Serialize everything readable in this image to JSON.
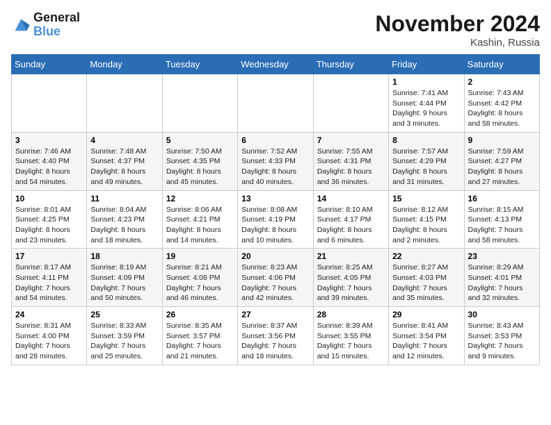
{
  "logo": {
    "line1": "General",
    "line2": "Blue"
  },
  "title": "November 2024",
  "location": "Kashin, Russia",
  "weekdays": [
    "Sunday",
    "Monday",
    "Tuesday",
    "Wednesday",
    "Thursday",
    "Friday",
    "Saturday"
  ],
  "weeks": [
    [
      {
        "day": "",
        "info": ""
      },
      {
        "day": "",
        "info": ""
      },
      {
        "day": "",
        "info": ""
      },
      {
        "day": "",
        "info": ""
      },
      {
        "day": "",
        "info": ""
      },
      {
        "day": "1",
        "info": "Sunrise: 7:41 AM\nSunset: 4:44 PM\nDaylight: 9 hours\nand 3 minutes."
      },
      {
        "day": "2",
        "info": "Sunrise: 7:43 AM\nSunset: 4:42 PM\nDaylight: 8 hours\nand 58 minutes."
      }
    ],
    [
      {
        "day": "3",
        "info": "Sunrise: 7:46 AM\nSunset: 4:40 PM\nDaylight: 8 hours\nand 54 minutes."
      },
      {
        "day": "4",
        "info": "Sunrise: 7:48 AM\nSunset: 4:37 PM\nDaylight: 8 hours\nand 49 minutes."
      },
      {
        "day": "5",
        "info": "Sunrise: 7:50 AM\nSunset: 4:35 PM\nDaylight: 8 hours\nand 45 minutes."
      },
      {
        "day": "6",
        "info": "Sunrise: 7:52 AM\nSunset: 4:33 PM\nDaylight: 8 hours\nand 40 minutes."
      },
      {
        "day": "7",
        "info": "Sunrise: 7:55 AM\nSunset: 4:31 PM\nDaylight: 8 hours\nand 36 minutes."
      },
      {
        "day": "8",
        "info": "Sunrise: 7:57 AM\nSunset: 4:29 PM\nDaylight: 8 hours\nand 31 minutes."
      },
      {
        "day": "9",
        "info": "Sunrise: 7:59 AM\nSunset: 4:27 PM\nDaylight: 8 hours\nand 27 minutes."
      }
    ],
    [
      {
        "day": "10",
        "info": "Sunrise: 8:01 AM\nSunset: 4:25 PM\nDaylight: 8 hours\nand 23 minutes."
      },
      {
        "day": "11",
        "info": "Sunrise: 8:04 AM\nSunset: 4:23 PM\nDaylight: 8 hours\nand 18 minutes."
      },
      {
        "day": "12",
        "info": "Sunrise: 8:06 AM\nSunset: 4:21 PM\nDaylight: 8 hours\nand 14 minutes."
      },
      {
        "day": "13",
        "info": "Sunrise: 8:08 AM\nSunset: 4:19 PM\nDaylight: 8 hours\nand 10 minutes."
      },
      {
        "day": "14",
        "info": "Sunrise: 8:10 AM\nSunset: 4:17 PM\nDaylight: 8 hours\nand 6 minutes."
      },
      {
        "day": "15",
        "info": "Sunrise: 8:12 AM\nSunset: 4:15 PM\nDaylight: 8 hours\nand 2 minutes."
      },
      {
        "day": "16",
        "info": "Sunrise: 8:15 AM\nSunset: 4:13 PM\nDaylight: 7 hours\nand 58 minutes."
      }
    ],
    [
      {
        "day": "17",
        "info": "Sunrise: 8:17 AM\nSunset: 4:11 PM\nDaylight: 7 hours\nand 54 minutes."
      },
      {
        "day": "18",
        "info": "Sunrise: 8:19 AM\nSunset: 4:09 PM\nDaylight: 7 hours\nand 50 minutes."
      },
      {
        "day": "19",
        "info": "Sunrise: 8:21 AM\nSunset: 4:08 PM\nDaylight: 7 hours\nand 46 minutes."
      },
      {
        "day": "20",
        "info": "Sunrise: 8:23 AM\nSunset: 4:06 PM\nDaylight: 7 hours\nand 42 minutes."
      },
      {
        "day": "21",
        "info": "Sunrise: 8:25 AM\nSunset: 4:05 PM\nDaylight: 7 hours\nand 39 minutes."
      },
      {
        "day": "22",
        "info": "Sunrise: 8:27 AM\nSunset: 4:03 PM\nDaylight: 7 hours\nand 35 minutes."
      },
      {
        "day": "23",
        "info": "Sunrise: 8:29 AM\nSunset: 4:01 PM\nDaylight: 7 hours\nand 32 minutes."
      }
    ],
    [
      {
        "day": "24",
        "info": "Sunrise: 8:31 AM\nSunset: 4:00 PM\nDaylight: 7 hours\nand 28 minutes."
      },
      {
        "day": "25",
        "info": "Sunrise: 8:33 AM\nSunset: 3:59 PM\nDaylight: 7 hours\nand 25 minutes."
      },
      {
        "day": "26",
        "info": "Sunrise: 8:35 AM\nSunset: 3:57 PM\nDaylight: 7 hours\nand 21 minutes."
      },
      {
        "day": "27",
        "info": "Sunrise: 8:37 AM\nSunset: 3:56 PM\nDaylight: 7 hours\nand 18 minutes."
      },
      {
        "day": "28",
        "info": "Sunrise: 8:39 AM\nSunset: 3:55 PM\nDaylight: 7 hours\nand 15 minutes."
      },
      {
        "day": "29",
        "info": "Sunrise: 8:41 AM\nSunset: 3:54 PM\nDaylight: 7 hours\nand 12 minutes."
      },
      {
        "day": "30",
        "info": "Sunrise: 8:43 AM\nSunset: 3:53 PM\nDaylight: 7 hours\nand 9 minutes."
      }
    ]
  ]
}
